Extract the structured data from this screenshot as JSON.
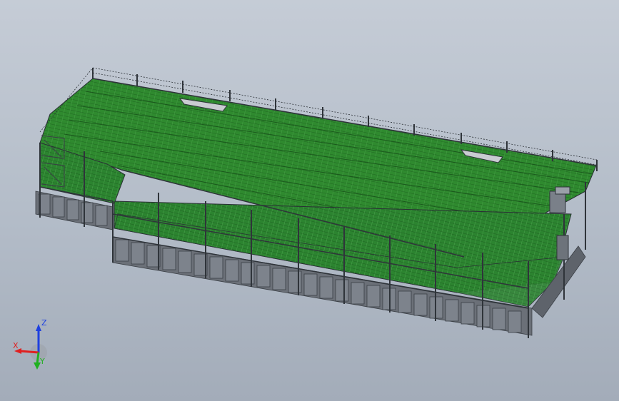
{
  "view": {
    "background_top": "#c5ccd6",
    "background_bottom": "#a3acb9"
  },
  "model": {
    "description_colors": {
      "floor": "#2f8a2f",
      "floor_dark": "#1f6a22",
      "frame": "#3a3f45",
      "panel": "#6b7078",
      "panel_light": "#8a9099"
    }
  },
  "triad": {
    "x_label": "X",
    "y_label": "Y",
    "z_label": "Z",
    "x_color": "#e02020",
    "y_color": "#20b020",
    "z_color": "#1e40e0"
  }
}
